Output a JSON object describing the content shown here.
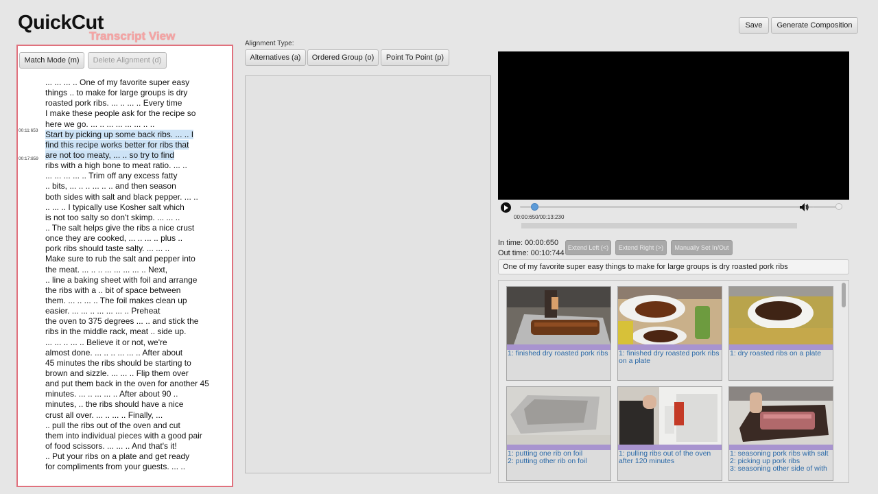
{
  "app": {
    "title": "QuickCut",
    "view_label": "Transcript View"
  },
  "header": {
    "save_label": "Save",
    "generate_label": "Generate Composition"
  },
  "transcript": {
    "match_mode_label": "Match Mode (m)",
    "delete_alignment_label": "Delete Alignment (d)",
    "timestamps": [
      "00:11:653",
      "00:17:859"
    ],
    "lines": [
      "... ... ... .. One of my favorite super easy",
      "things .. to make for large groups is dry",
      "roasted pork ribs. ... .. ... .. Every time",
      "I make these people ask for the recipe so",
      "here we go. ... .. ... ... ... ... .. ..",
      "Start by picking up some back ribs. ... .. I",
      "find this recipe works better for ribs that",
      "are not too meaty, ... .. so try to find",
      "ribs with a high bone to meat ratio. ... ..",
      "... ... ... ... .. Trim off any excess fatty",
      ".. bits, ... .. .. ... .. .. and then season",
      "both sides with salt and black pepper. ... ..",
      ".. ... .. I typically use Kosher salt which",
      "is not too salty so don't skimp. ... ... ..",
      ".. The salt helps give the ribs a nice crust",
      "once they are cooked, ... .. ... .. plus ..",
      "pork ribs should taste salty. ... ... ..",
      "Make sure to rub the salt and pepper into",
      "the meat. ... .. .. ... ... ... ... .. Next,",
      ".. line a baking sheet with foil and arrange",
      "the ribs with a .. bit of space between",
      "them. ... .. ... .. The foil makes clean up",
      "easier. ... ... .. ... ... ... .. Preheat",
      "the oven to 375 degrees ... .. and stick the",
      "ribs in the middle rack, meat .. side up.",
      "... ... .. ... .. Believe it or not, we're",
      "almost done. ... .. .. ... ... .. After about",
      "45 minutes the ribs should be starting to",
      "brown and sizzle. ... ... .. Flip them over",
      "and put them back in the oven for another 45",
      "minutes. ... .. ... ... .. After about 90 ..",
      "minutes, .. the ribs should have a nice",
      "crust all over. ... .. ... .. Finally, ...",
      ".. pull the ribs out of the oven and cut",
      "them into individual pieces with a good pair",
      "of food scissors. ... ... .. And that's it!",
      ".. Put your ribs on a plate and get ready",
      "for compliments from your guests. ... .."
    ]
  },
  "alignment": {
    "type_label": "Alignment Type:",
    "buttons": [
      "Alternatives (a)",
      "Ordered Group (o)",
      "Point To Point (p)"
    ]
  },
  "player": {
    "time_display": "00:00:650/00:13:230",
    "position_fraction": 0.049,
    "volume_fraction": 1.0
  },
  "inout": {
    "in_time": "In time: 00:00:650",
    "out_time": "Out time: 00:10:744",
    "extend_left_label": "Extend Left (<)",
    "extend_right_label": "Extend Right (>)",
    "manual_label": "Manually Set In/Out"
  },
  "caption": "One of my favorite super easy things to make for large groups is dry roasted pork ribs",
  "thumbnails": [
    {
      "labels": [
        "1: finished dry roasted pork ribs"
      ]
    },
    {
      "labels": [
        "1: finished dry roasted pork ribs on a plate"
      ]
    },
    {
      "labels": [
        "1: dry roasted ribs on a plate"
      ]
    },
    {
      "labels": [
        "1: putting one rib on foil",
        "2: putting other rib on foil"
      ]
    },
    {
      "labels": [
        "1: pulling ribs out of the oven after 120 minutes"
      ]
    },
    {
      "labels": [
        "1: seasoning pork ribs with salt",
        "2: picking up pork ribs",
        "3: seasoning other side of with"
      ]
    }
  ],
  "colors": {
    "highlight": "#cde3f6",
    "panel_border": "#e0717d",
    "label_link": "#2c6aa8",
    "strip": "#a894cf"
  }
}
